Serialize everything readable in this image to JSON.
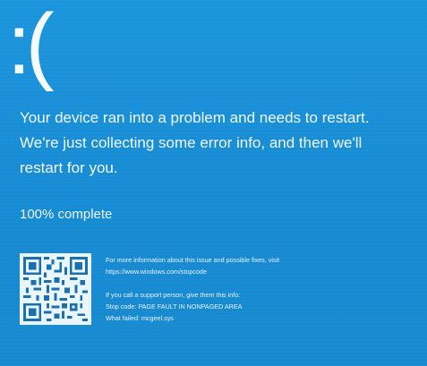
{
  "bsod": {
    "sad_face": ":(",
    "message_line1": "Your device ran into a problem and needs to restart.",
    "message_line2": "We're just collecting some error info, and then we'll",
    "message_line3": "restart for you.",
    "progress": "100% complete",
    "progress_percent": 100,
    "info_line1": "For more information about this issue and possible fixes, visit",
    "info_url": "https://www.windows.com/stopcode",
    "support_line": "If you call a support person, give them this info:",
    "stop_code": "Stop code: PAGE FAULT IN NONPAGED AREA",
    "what_failed": "What failed: mcgeel.sys"
  },
  "colors": {
    "background": "#1a8fd6",
    "text": "#ffffff"
  },
  "icons": {
    "qr": "qr-code-icon"
  }
}
